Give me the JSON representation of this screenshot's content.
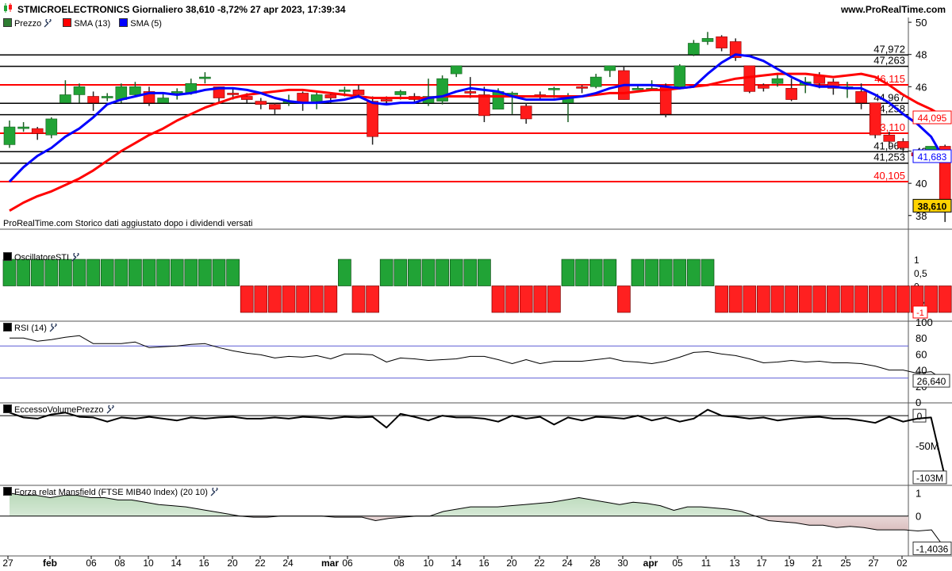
{
  "header": {
    "title": "STMICROELECTRONICS Giornaliero 38,610 -8,72% 27 apr 2023, 17:39:34",
    "site": "www.ProRealTime.com"
  },
  "main_legend": [
    {
      "label": "Prezzo",
      "color": "#2e7d32"
    },
    {
      "label": "SMA (13)",
      "color": "#ff0000"
    },
    {
      "label": "SMA (5)",
      "color": "#0000ff"
    }
  ],
  "note": "ProRealTime.com Storico dati aggiustato dopo i dividendi versati",
  "panel_titles": {
    "osc": "OscillatoreSTI",
    "rsi": "RSI (14)",
    "vol": "EccessoVolumePrezzo",
    "mans": "Forza relat Mansfield (FTSE MIB40 Index) (20 10)"
  },
  "x_ticks": [
    "27",
    "feb",
    "06",
    "08",
    "10",
    "14",
    "16",
    "20",
    "22",
    "24",
    "mar",
    "06",
    "08",
    "10",
    "14",
    "16",
    "20",
    "22",
    "24",
    "28",
    "30",
    "apr",
    "05",
    "11",
    "13",
    "17",
    "19",
    "21",
    "25",
    "27",
    "02"
  ],
  "colors": {
    "up": "#21a336",
    "down": "#ff1a1a",
    "sma13": "#ff0000",
    "sma5": "#0000ff",
    "grid": "#000000"
  },
  "chart_data": [
    {
      "type": "candlestick",
      "title": "STMICROELECTRONICS Giornaliero",
      "ylim": [
        37.2,
        50.3
      ],
      "y_ticks": [
        "50",
        "48",
        "46",
        "44",
        "42",
        "40",
        "38"
      ],
      "candles": [
        [
          42.4,
          43.5,
          42.2,
          43.9
        ],
        [
          43.4,
          43.5,
          43.2,
          43.8
        ],
        [
          43.4,
          43.1,
          42.7,
          43.5
        ],
        [
          43.0,
          44.0,
          42.8,
          44.1
        ],
        [
          45.0,
          45.5,
          45.0,
          46.4
        ],
        [
          45.5,
          46.0,
          45.0,
          46.2
        ],
        [
          45.4,
          45.0,
          44.5,
          45.7
        ],
        [
          45.4,
          45.4,
          45.1,
          45.6
        ],
        [
          45.2,
          46.0,
          45.0,
          46.2
        ],
        [
          45.5,
          46.0,
          45.4,
          46.3
        ],
        [
          45.7,
          45.0,
          44.8,
          46.0
        ],
        [
          45.0,
          45.3,
          45.0,
          45.6
        ],
        [
          45.6,
          45.7,
          45.2,
          45.9
        ],
        [
          45.6,
          46.2,
          45.5,
          46.5
        ],
        [
          46.6,
          46.6,
          46.2,
          46.9
        ],
        [
          46.0,
          45.3,
          45.0,
          46.0
        ],
        [
          45.6,
          45.5,
          45.2,
          45.9
        ],
        [
          45.4,
          45.2,
          45.0,
          45.6
        ],
        [
          45.1,
          44.9,
          44.6,
          45.3
        ],
        [
          44.9,
          44.6,
          44.3,
          45.0
        ],
        [
          45.0,
          45.1,
          44.8,
          45.5
        ],
        [
          45.6,
          45.0,
          44.5,
          45.7
        ],
        [
          45.1,
          45.5,
          44.6,
          45.7
        ],
        [
          45.5,
          45.3,
          45.0,
          45.6
        ],
        [
          45.8,
          45.8,
          45.4,
          46.0
        ],
        [
          45.8,
          45.5,
          45.3,
          46.1
        ],
        [
          45.1,
          42.9,
          42.4,
          45.4
        ],
        [
          45.2,
          45.1,
          45.0,
          45.4
        ],
        [
          45.5,
          45.7,
          45.2,
          45.8
        ],
        [
          45.4,
          45.2,
          45.0,
          45.6
        ],
        [
          45.0,
          45.4,
          44.8,
          46.5
        ],
        [
          45.1,
          46.5,
          44.9,
          46.7
        ],
        [
          46.8,
          47.3,
          46.6,
          47.3
        ],
        [
          45.7,
          45.6,
          45.3,
          46.6
        ],
        [
          45.5,
          44.2,
          43.8,
          46.0
        ],
        [
          44.6,
          45.7,
          44.6,
          45.9
        ],
        [
          45.6,
          45.6,
          44.3,
          45.7
        ],
        [
          44.8,
          44.0,
          43.7,
          45.0
        ],
        [
          45.5,
          45.4,
          45.2,
          45.7
        ],
        [
          45.9,
          45.9,
          45.3,
          46.0
        ],
        [
          45.0,
          45.4,
          43.8,
          45.6
        ],
        [
          46.0,
          45.9,
          45.6,
          46.1
        ],
        [
          46.0,
          46.6,
          45.9,
          46.8
        ],
        [
          47.0,
          47.3,
          46.6,
          47.3
        ],
        [
          47.0,
          45.2,
          45.2,
          47.3
        ],
        [
          45.8,
          45.9,
          45.8,
          46.1
        ],
        [
          45.9,
          45.9,
          45.8,
          46.4
        ],
        [
          46.0,
          44.3,
          44.1,
          46.2
        ],
        [
          46.0,
          47.3,
          46.0,
          47.4
        ],
        [
          48.0,
          48.7,
          47.9,
          48.9
        ],
        [
          48.8,
          49.0,
          48.6,
          49.4
        ],
        [
          49.1,
          48.4,
          48.2,
          49.2
        ],
        [
          48.8,
          47.8,
          47.6,
          49.0
        ],
        [
          47.3,
          45.7,
          45.6,
          47.3
        ],
        [
          46.1,
          45.9,
          45.7,
          46.2
        ],
        [
          46.2,
          46.5,
          46.0,
          46.8
        ],
        [
          45.9,
          45.2,
          45.1,
          46.5
        ],
        [
          46.1,
          46.3,
          45.6,
          46.6
        ],
        [
          46.7,
          46.2,
          45.9,
          46.9
        ],
        [
          46.3,
          45.9,
          45.5,
          46.5
        ],
        [
          46.0,
          46.0,
          45.3,
          46.3
        ],
        [
          45.7,
          45.0,
          44.6,
          46.2
        ],
        [
          45.0,
          43.0,
          42.8,
          45.0
        ],
        [
          43.0,
          42.6,
          42.2,
          43.2
        ],
        [
          42.6,
          42.2,
          41.9,
          42.8
        ],
        [
          41.9,
          41.7,
          41.3,
          42.0
        ],
        [
          41.4,
          42.3,
          41.3,
          42.3
        ],
        [
          42.3,
          38.61,
          37.6,
          42.4
        ]
      ],
      "sma5": [
        40.1,
        41.0,
        41.7,
        42.2,
        42.9,
        43.4,
        44.1,
        44.9,
        45.2,
        45.4,
        45.6,
        45.6,
        45.5,
        45.6,
        45.8,
        45.9,
        45.9,
        45.8,
        45.6,
        45.3,
        45.1,
        45.0,
        45.0,
        45.1,
        45.2,
        45.4,
        45.0,
        44.9,
        45.0,
        45.0,
        45.3,
        45.4,
        45.7,
        45.9,
        45.8,
        45.7,
        45.4,
        45.2,
        45.2,
        45.2,
        45.3,
        45.4,
        45.6,
        45.9,
        46.1,
        46.1,
        46.1,
        46.0,
        45.9,
        46.0,
        46.8,
        47.5,
        48.0,
        47.9,
        47.6,
        47.1,
        46.6,
        46.2,
        46.0,
        46.0,
        45.9,
        45.9,
        45.5,
        45.0,
        44.3,
        43.7,
        42.9,
        41.4
      ],
      "sma13": [
        38.3,
        38.8,
        39.2,
        39.5,
        39.9,
        40.3,
        40.8,
        41.4,
        42.0,
        42.5,
        43.0,
        43.4,
        43.9,
        44.3,
        44.7,
        45.0,
        45.3,
        45.5,
        45.6,
        45.7,
        45.8,
        45.8,
        45.7,
        45.6,
        45.5,
        45.4,
        45.3,
        45.3,
        45.3,
        45.3,
        45.3,
        45.4,
        45.4,
        45.4,
        45.4,
        45.4,
        45.4,
        45.4,
        45.4,
        45.4,
        45.4,
        45.4,
        45.5,
        45.6,
        45.6,
        45.7,
        45.8,
        45.8,
        45.9,
        46.0,
        46.1,
        46.3,
        46.5,
        46.6,
        46.7,
        46.8,
        46.8,
        46.8,
        46.7,
        46.6,
        46.7,
        46.8,
        46.6,
        46.1,
        45.5,
        45.0,
        44.6,
        44.095
      ],
      "levels": [
        {
          "value": 47.972,
          "label": "47,972",
          "color": "#000000"
        },
        {
          "value": 47.263,
          "label": "47,263",
          "color": "#000000"
        },
        {
          "value": 46.115,
          "label": "46,115",
          "color": "#ff0000"
        },
        {
          "value": 44.967,
          "label": "44,967",
          "color": "#000000"
        },
        {
          "value": 44.258,
          "label": "44,258",
          "color": "#000000"
        },
        {
          "value": 43.11,
          "label": "43,110",
          "color": "#ff0000"
        },
        {
          "value": 41.962,
          "label": "41,962",
          "color": "#000000"
        },
        {
          "value": 41.253,
          "label": "41,253",
          "color": "#000000"
        },
        {
          "value": 40.105,
          "label": "40,105",
          "color": "#ff0000"
        }
      ],
      "last_labels": [
        {
          "value": 44.095,
          "label": "44,095",
          "color": "#ff0000"
        },
        {
          "value": 41.683,
          "label": "41,683",
          "color": "#0000ff"
        },
        {
          "value": 38.61,
          "label": "38,610",
          "color": "#000000",
          "fill": "#ffd400"
        }
      ]
    },
    {
      "type": "bar",
      "title": "OscillatoreSTI",
      "ylim": [
        -1.3,
        1.3
      ],
      "y_ticks": [
        "1",
        "0,5",
        "0",
        "-0,5"
      ],
      "values": [
        1,
        1,
        1,
        1,
        1,
        1,
        1,
        1,
        1,
        1,
        1,
        1,
        1,
        1,
        1,
        1,
        1,
        -1,
        -1,
        -1,
        -1,
        -1,
        -1,
        -1,
        1,
        -1,
        -1,
        1,
        1,
        1,
        1,
        1,
        1,
        1,
        1,
        -1,
        -1,
        -1,
        -1,
        -1,
        1,
        1,
        1,
        1,
        -1,
        1,
        1,
        1,
        1,
        1,
        1,
        -1,
        -1,
        -1,
        -1,
        -1,
        -1,
        -1,
        -1,
        -1,
        -1,
        -1,
        -1,
        -1,
        -1,
        -1,
        -1,
        -1
      ],
      "last_label": "-1"
    },
    {
      "type": "line",
      "title": "RSI (14)",
      "ylim": [
        0,
        100
      ],
      "y_ticks": [
        "100",
        "80",
        "60",
        "40",
        "20",
        "0"
      ],
      "hlines": [
        70,
        30
      ],
      "values": [
        80,
        80,
        76,
        78,
        81,
        83,
        73,
        73,
        73,
        75,
        68,
        69,
        70,
        72,
        73,
        68,
        64,
        61,
        59,
        55,
        57,
        56,
        58,
        54,
        60,
        60,
        59,
        50,
        55,
        54,
        52,
        53,
        54,
        57,
        57,
        53,
        48,
        53,
        48,
        51,
        51,
        51,
        53,
        55,
        51,
        50,
        48,
        51,
        56,
        62,
        63,
        60,
        58,
        54,
        49,
        50,
        52,
        50,
        51,
        49,
        49,
        48,
        45,
        40,
        40,
        36,
        38,
        26.64
      ],
      "last_label": "26,640"
    },
    {
      "type": "line",
      "title": "EccessoVolumePrezzo",
      "ylim": [
        -115,
        20
      ],
      "y_ticks": [
        "0",
        "-50M",
        "-100M"
      ],
      "values": [
        5,
        -3,
        -5,
        2,
        5,
        -2,
        -3,
        -10,
        -3,
        -5,
        -2,
        -5,
        -8,
        -3,
        -5,
        -3,
        -2,
        -5,
        -5,
        -3,
        -5,
        -2,
        -3,
        -5,
        -2,
        -3,
        -2,
        -20,
        3,
        -2,
        -8,
        0,
        -3,
        -3,
        -5,
        -10,
        0,
        -5,
        -2,
        -15,
        -3,
        -8,
        -2,
        -3,
        -5,
        0,
        -8,
        -3,
        -10,
        -5,
        10,
        0,
        -2,
        -5,
        -3,
        -8,
        -5,
        -3,
        -2,
        -5,
        -5,
        -8,
        -12,
        -2,
        -10,
        -5,
        -3,
        -103
      ],
      "last_label": "-103M"
    },
    {
      "type": "area",
      "title": "Forza relat Mansfield (FTSE MIB40 Index) (20 10)",
      "ylim": [
        -1.7,
        1.3
      ],
      "y_ticks": [
        "1",
        "0"
      ],
      "values": [
        1,
        0.9,
        0.9,
        0.8,
        0.9,
        0.9,
        0.8,
        0.8,
        0.7,
        0.7,
        0.6,
        0.5,
        0.45,
        0.4,
        0.3,
        0.2,
        0.1,
        0,
        -0.05,
        -0.05,
        0,
        0,
        0,
        0,
        -0.05,
        -0.05,
        -0.05,
        -0.2,
        -0.1,
        -0.05,
        0,
        0,
        0.2,
        0.3,
        0.4,
        0.4,
        0.4,
        0.45,
        0.5,
        0.55,
        0.6,
        0.7,
        0.8,
        0.7,
        0.6,
        0.5,
        0.6,
        0.55,
        0.45,
        0.25,
        0.4,
        0.4,
        0.35,
        0.3,
        0.2,
        0,
        -0.2,
        -0.25,
        -0.3,
        -0.4,
        -0.4,
        -0.5,
        -0.45,
        -0.5,
        -0.6,
        -0.6,
        -0.6,
        -0.65,
        -0.6,
        -1.4036
      ],
      "last_label": "-1,4036"
    }
  ]
}
